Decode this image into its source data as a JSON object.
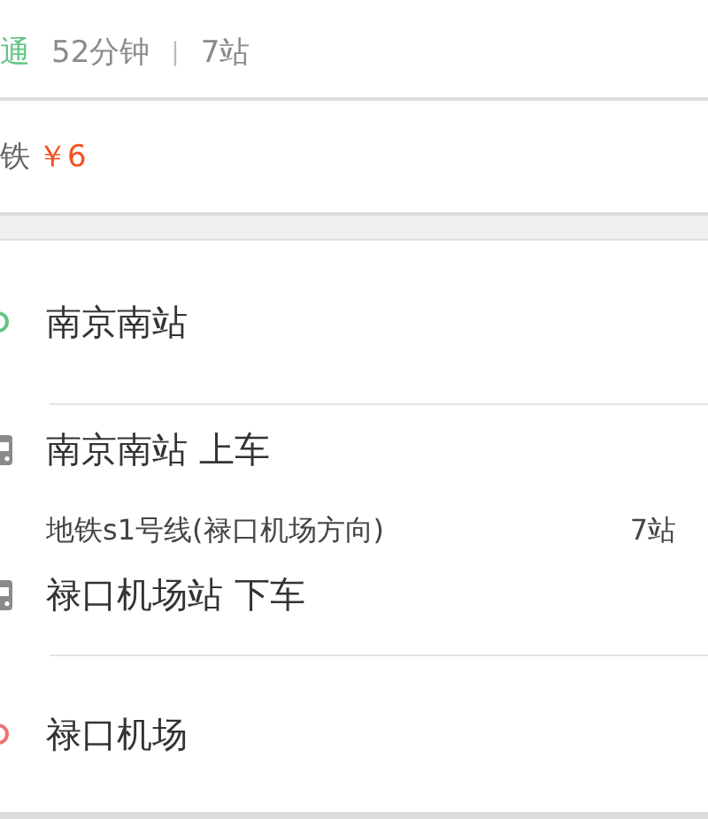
{
  "summary": {
    "tag": "通",
    "duration": "52分钟",
    "separator": "|",
    "stops": "7站"
  },
  "fare": {
    "label": "铁",
    "price": "￥6"
  },
  "steps": [
    {
      "kind": "start",
      "title": "南京南站"
    },
    {
      "kind": "board",
      "title": "南京南站 上车",
      "line": "地铁s1号线(禄口机场方向)",
      "stops": "7站"
    },
    {
      "kind": "alight",
      "title": "禄口机场站 下车"
    },
    {
      "kind": "end",
      "title": "禄口机场"
    }
  ]
}
